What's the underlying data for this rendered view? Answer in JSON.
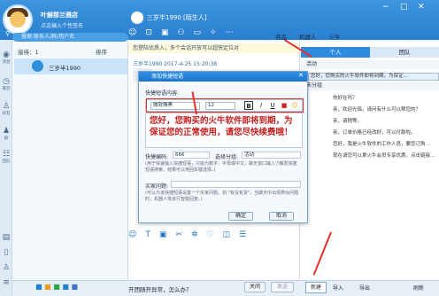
{
  "colors": {
    "accent": "#2a7fcf",
    "arrow": "#e8302b",
    "editor_text": "#c22020"
  },
  "header": {
    "shop_name": "叶赫那兰雅店",
    "signature": "点这编入个性签名",
    "chat_title": "三岁半1990 [陌生人]"
  },
  "top_tabs": [
    "商品",
    "机器人",
    "火牛"
  ],
  "search": {
    "placeholder": "搜索:联系人/群/用户名"
  },
  "contacts": {
    "header_left": "接待：1",
    "header_right": "排序",
    "items": [
      {
        "name": "三岁半1990"
      }
    ]
  },
  "left_nav": [
    "消息",
    "最近",
    "好友",
    "群",
    "团队"
  ],
  "chat": {
    "notice": "您登陆优质入，多个会话开放可以超快定位对",
    "msg_head": "三岁半1990 2017-4-25 15:20:38"
  },
  "right_panel": {
    "tabs": [
      "个人",
      "团队"
    ],
    "section1": "活动",
    "line_top": "您好，您购买的火牛软件即将到期，为保证…",
    "section2": "未分组",
    "lines": [
      "你好在吗？",
      "亲，欢迎光临，请问有什么可以帮您的？",
      "亲，请稍等。",
      "亲，订单价格已经改好，可以付款啦。",
      "您好，我是火牛软件的工作人员，要您订购…",
      "现在请您可以拿火牛会员专享优惠，点击链接…"
    ]
  },
  "dialog": {
    "title": "添加快捷短语",
    "content_label": "快捷短语内容:",
    "font": "微软雅黑",
    "size": "12",
    "text": "您好，您购买的火牛软件即将到期，为保证您的正常使用，请您尽快续费哦！",
    "shortcut_label": "快捷编码:",
    "shortcut_value": "666",
    "group_label": "选择分组:",
    "group_value": "活动",
    "shortcut_hint": "(用于快速输入快捷短语，只能为数字、字母或中文，聊天窗口输入'/'触发快捷短语搜索，结果可以用回车键选择。)",
    "keyword_label": "买家问题:",
    "keyword_hint": "(可以为该快捷短语设置一个买家问题，如 \"有没有货\"，当聊天中出现类似问题时，机器人将进行智能回复。)",
    "ok": "确定",
    "cancel": "取消"
  },
  "bottom": {
    "status": "开团随开异常，怎么办？",
    "close": "关闭",
    "send": "发送",
    "new": "新建",
    "import": "导入",
    "export": "导出",
    "refresh": "刷新"
  }
}
